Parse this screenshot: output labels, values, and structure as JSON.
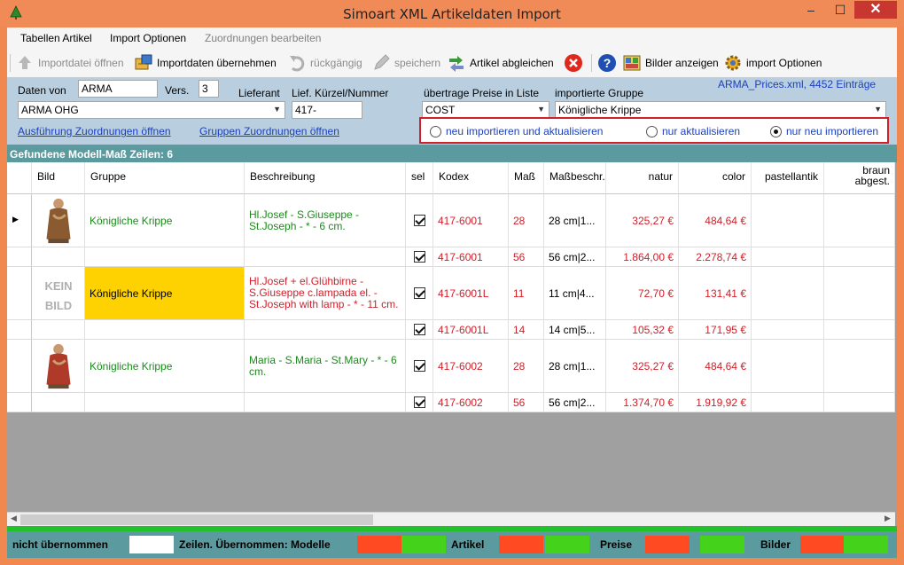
{
  "window": {
    "title": "Simoart XML Artikeldaten Import",
    "minimize": "–",
    "maximize": "☐",
    "close": "✕"
  },
  "menu": {
    "items": [
      "Tabellen Artikel",
      "Import Optionen",
      "Zuordnungen bearbeiten"
    ]
  },
  "toolbar": {
    "open_file": "Importdatei öffnen",
    "apply_import": "Importdaten übernehmen",
    "undo": "rückgängig",
    "save": "speichern",
    "compare": "Artikel abgleichen",
    "show_images": "Bilder anzeigen",
    "import_options": "import Optionen"
  },
  "form": {
    "daten_von_label": "Daten von",
    "daten_von_value": "ARMA",
    "vers_label": "Vers.",
    "vers_value": "3",
    "lieferant_label": "Lieferant",
    "lieferant_value": "ARMA OHG",
    "kuerzel_label": "Lief. Kürzel/Nummer",
    "kuerzel_value": "417-",
    "preise_label": "übertrage Preise in Liste",
    "preise_value": "COST",
    "gruppe_label": "importierte Gruppe",
    "gruppe_value": "Königliche Krippe",
    "file_info": "ARMA_Prices.xml, 4452 Einträge",
    "link_ausfuehrung": "Ausführung Zuordnungen öffnen",
    "link_gruppen": "Gruppen Zuordnungen öffnen",
    "radio_options": [
      "neu importieren und aktualisieren",
      "nur aktualisieren",
      "nur neu importieren"
    ],
    "radio_selected": 2
  },
  "section_title": "Gefundene Modell-Maß Zeilen: 6",
  "table": {
    "columns": [
      "Bild",
      "Gruppe",
      "Beschreibung",
      "sel",
      "Kodex",
      "Maß",
      "Maßbeschr.",
      "natur",
      "color",
      "pastellantik",
      "braun abgest."
    ],
    "kein_bild": [
      "KEIN",
      "BILD"
    ],
    "rows": [
      {
        "gruppe": "Königliche Krippe",
        "beschreibung": "Hl.Josef - S.Giuseppe - St.Joseph - * - 6 cm.",
        "kodex": "417-6001",
        "mass": "28",
        "massbeschr": "28 cm|1...",
        "natur": "325,27 €",
        "color": "484,64 €"
      },
      {
        "gruppe": "",
        "beschreibung": "",
        "kodex": "417-6001",
        "mass": "56",
        "massbeschr": "56 cm|2...",
        "natur": "1.864,00 €",
        "color": "2.278,74 €"
      },
      {
        "gruppe": "Königliche Krippe",
        "beschreibung": "Hl.Josef + el.Glühbirne - S.Giuseppe c.lampada el. - St.Joseph with lamp - * - 11 cm.",
        "kodex": "417-6001L",
        "mass": "11",
        "massbeschr": "11 cm|4...",
        "natur": "72,70 €",
        "color": "131,41 €"
      },
      {
        "gruppe": "",
        "beschreibung": "",
        "kodex": "417-6001L",
        "mass": "14",
        "massbeschr": "14 cm|5...",
        "natur": "105,32 €",
        "color": "171,95 €"
      },
      {
        "gruppe": "Königliche Krippe",
        "beschreibung": "Maria - S.Maria - St.Mary - * - 6 cm.",
        "kodex": "417-6002",
        "mass": "28",
        "massbeschr": "28 cm|1...",
        "natur": "325,27 €",
        "color": "484,64 €"
      },
      {
        "gruppe": "",
        "beschreibung": "",
        "kodex": "417-6002",
        "mass": "56",
        "massbeschr": "56 cm|2...",
        "natur": "1.374,70 €",
        "color": "1.919,92 €"
      }
    ]
  },
  "status": {
    "nicht": "nicht übernommen",
    "zeilen": "Zeilen. Übernommen: Modelle",
    "artikel": "Artikel",
    "preise": "Preise",
    "bilder": "Bilder"
  },
  "colors": {
    "accent_red": "#d0202a",
    "accent_green": "#1a8a1a",
    "highlight": "#fdd200",
    "swatch_red": "#ff4a22",
    "swatch_green": "#44d21a"
  }
}
